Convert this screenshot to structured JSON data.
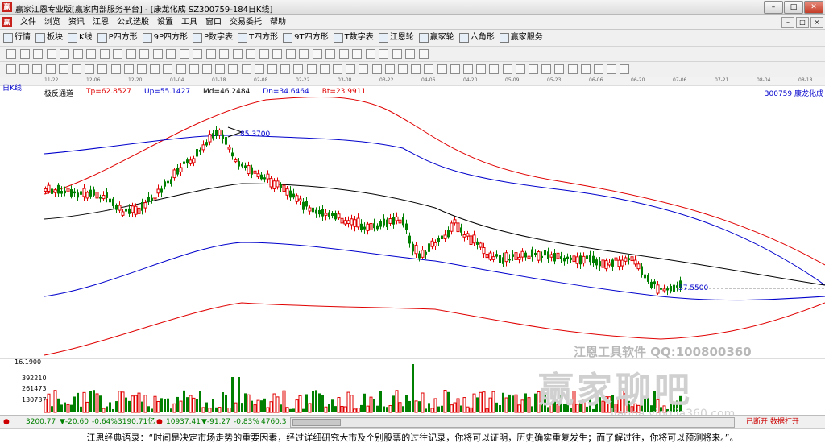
{
  "window": {
    "title": "赢家江恩专业版[赢家内部服务平台] - [康龙化成  SZ300759-184日K线]",
    "logo_text": "赢"
  },
  "menu": {
    "items": [
      "文件",
      "浏览",
      "资讯",
      "江恩",
      "公式选股",
      "设置",
      "工具",
      "窗口",
      "交易委托",
      "帮助"
    ]
  },
  "toolbar": {
    "items": [
      {
        "label": "行情",
        "icon": "grid-icon"
      },
      {
        "label": "板块",
        "icon": "blocks-icon"
      },
      {
        "label": "K线",
        "icon": "candlestick-icon"
      },
      {
        "label": "P四方形",
        "icon": "p-square-icon"
      },
      {
        "label": "9P四方形",
        "icon": "9p-square-icon"
      },
      {
        "label": "P数字表",
        "icon": "p-table-icon"
      },
      {
        "label": "T四方形",
        "icon": "t-square-icon"
      },
      {
        "label": "9T四方形",
        "icon": "9t-square-icon"
      },
      {
        "label": "T数字表",
        "icon": "t-table-icon"
      },
      {
        "label": "江恩轮",
        "icon": "gann-wheel-icon"
      },
      {
        "label": "赢家轮",
        "icon": "winner-wheel-icon"
      },
      {
        "label": "六角形",
        "icon": "hexagon-icon"
      },
      {
        "label": "赢家服务",
        "icon": "service-icon"
      }
    ]
  },
  "chart": {
    "period_label": "日K线",
    "dates": [
      "11-22",
      "12-06",
      "12-20",
      "01-04",
      "01-18",
      "02-08",
      "02-22",
      "03-08",
      "03-22",
      "04-06",
      "04-20",
      "05-09",
      "05-23",
      "06-06",
      "06-20",
      "07-06",
      "07-21",
      "08-04",
      "08-18"
    ],
    "indicator": {
      "name": "极反通道",
      "tp": "Tp=62.8527",
      "up": "Up=55.1427",
      "md": "Md=46.2484",
      "dn": "Dn=34.6464",
      "bt": "Bt=23.9911"
    },
    "stock": "300759  康龙化成",
    "high_marker": "85.3700",
    "low_marker": "37.5500",
    "volume": {
      "max_label": "16.1900",
      "levels": [
        "392210",
        "261473",
        "130737"
      ]
    }
  },
  "chart_data": {
    "type": "candlestick",
    "title": "康龙化成 SZ300759 日K线",
    "x_ticks": [
      "11-22",
      "12-06",
      "12-20",
      "01-04",
      "01-18",
      "02-08",
      "02-22",
      "03-08",
      "03-22",
      "04-06",
      "04-20",
      "05-09",
      "05-23",
      "06-06",
      "06-20",
      "07-06",
      "07-21",
      "08-04",
      "08-18"
    ],
    "price_labels": {
      "high": 85.37,
      "low": 37.55
    },
    "channel_latest": {
      "Tp": 62.8527,
      "Up": 55.1427,
      "Md": 46.2484,
      "Dn": 34.6464,
      "Bt": 23.9911
    },
    "volume_axis": [
      392210,
      261473,
      130737
    ]
  },
  "watermark": {
    "line1": "江恩工具软件  QQ:100800360",
    "line2": "赢家聊吧",
    "line3": "liaoba.yingjia360.com"
  },
  "status": {
    "sh": "3200.77",
    "sh_chg": "▼-20.60",
    "sh_pct": "-0.64%",
    "sh_amt": "3190.71亿",
    "sz": "10937.41",
    "sz_chg": "▼-91.27",
    "sz_pct": "-0.83%",
    "sz_amt": "4760.3",
    "right": "已断开 数据打开"
  },
  "quote": "江恩经典语录：“时间是决定市场走势的重要因素，经过详细研究大市及个别股票的过往记录，你将可以证明，历史确实重复发生；而了解过往，你将可以预测将来。”。"
}
